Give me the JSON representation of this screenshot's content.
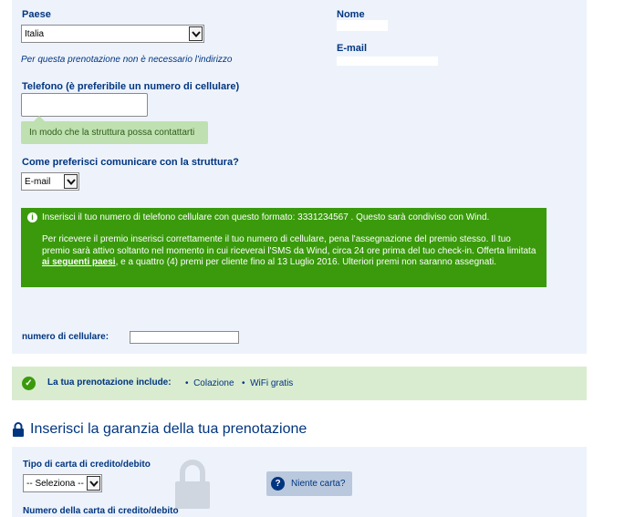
{
  "country": {
    "label": "Paese",
    "value": "Italia",
    "note": "Per questa prenotazione non è necessario l'indirizzo"
  },
  "guest": {
    "name_label": "Nome",
    "email_label": "E-mail"
  },
  "phone": {
    "label": "Telefono (è preferibile un numero di cellulare)",
    "value": "",
    "hint": "In modo che la struttura possa contattarti"
  },
  "contact_pref": {
    "label": "Come preferisci comunicare con la struttura?",
    "value": "E-mail"
  },
  "promo": {
    "line1": "Inserisci il tuo numero di telefono cellulare con questo formato: 3331234567 . Questo sarà condiviso con Wind.",
    "line2_before": "Per ricevere il premio inserisci correttamente il tuo numero di cellulare, pena l'assegnazione del premio stesso. Il tuo premio sarà attivo soltanto nel momento in cui riceverai l'SMS da Wind, circa 24 ore prima del tuo check-in. Offerta limitata ",
    "link": "ai seguenti paesi",
    "line2_after": ", e a quattro (4) premi per cliente fino al 13 Luglio 2016. Ulteriori premi non saranno assegnati."
  },
  "mobile": {
    "label": "numero di cellulare:",
    "value": ""
  },
  "includes": {
    "label": "La tua prenotazione include:",
    "items": [
      "Colazione",
      "WiFi gratis"
    ]
  },
  "guarantee": {
    "title": "Inserisci la garanzia della tua prenotazione",
    "card_type_label": "Tipo di carta di credito/debito",
    "card_type_value": "-- Seleziona --",
    "no_card": "Niente carta?",
    "card_number_label": "Numero della carta di credito/debito"
  },
  "colors": {
    "accent": "#003580",
    "promo_green": "#3a9a0c",
    "panel": "#eef3fb"
  }
}
